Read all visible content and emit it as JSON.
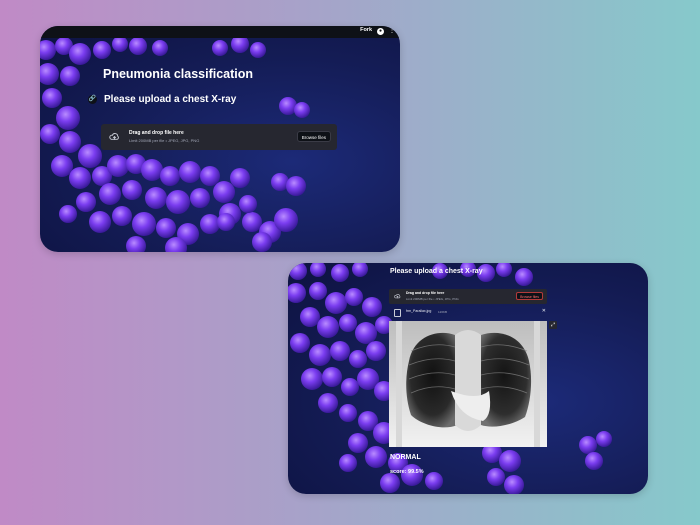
{
  "header": {
    "fork_label": "Fork",
    "github_icon": "github-icon",
    "menu_icon": "more-vert-icon"
  },
  "app": {
    "title": "Pneumonia classification",
    "subtitle": "Please upload a chest X-ray"
  },
  "uploader": {
    "main_text": "Drag and drop file here",
    "limit_text": "Limit 200MB per file • JPEG, JPG, PNG",
    "browse_label": "Browse files",
    "icon": "cloud-upload-icon"
  },
  "uploaded_file": {
    "name": "frm_Parallax.jpg",
    "size": "126KB",
    "icon": "file-icon",
    "remove_icon": "close-icon"
  },
  "result": {
    "class_label": "NORMAL",
    "score_text": "score: 99.5%"
  },
  "colors": {
    "page_left": "#c08ac6",
    "page_right": "#86c9cb",
    "card_bg": "#141c55",
    "blob": "#7b3df0",
    "uploader_bg": "#262730",
    "topbar": "#0e1117"
  }
}
